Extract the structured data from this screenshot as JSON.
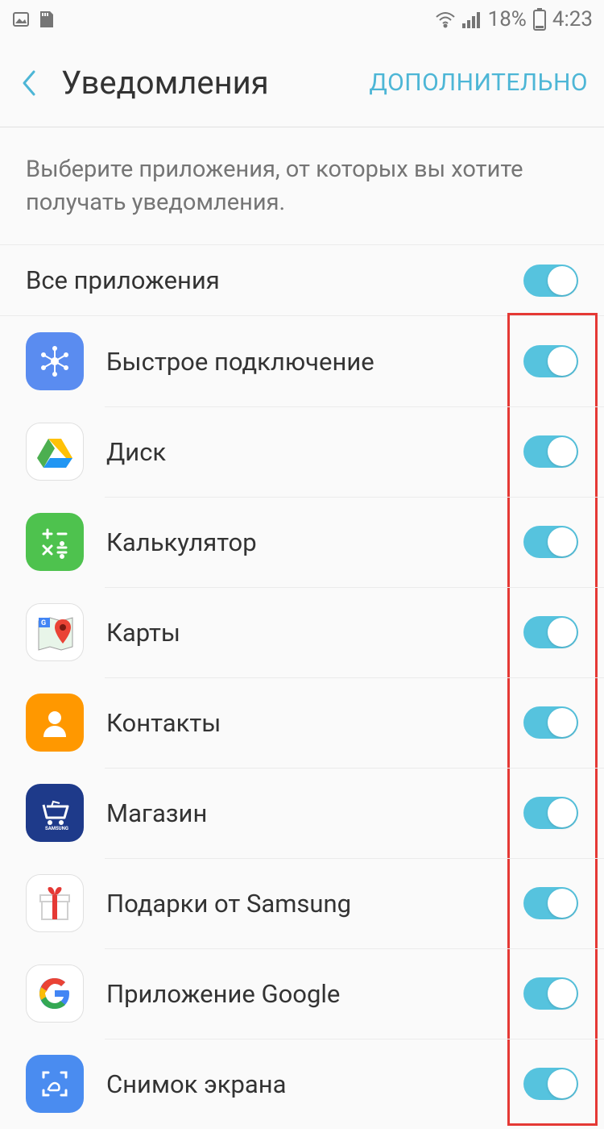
{
  "statusbar": {
    "battery_percent": "18%",
    "time": "4:23"
  },
  "header": {
    "title": "Уведомления",
    "action": "ДОПОЛНИТЕЛЬНО"
  },
  "description": "Выберите приложения, от которых вы хотите получать уведомления.",
  "all_apps": {
    "label": "Все приложения",
    "enabled": true
  },
  "apps": [
    {
      "name": "Быстрое подключение",
      "icon": "quick-connect",
      "enabled": true
    },
    {
      "name": "Диск",
      "icon": "drive",
      "enabled": true
    },
    {
      "name": "Калькулятор",
      "icon": "calculator",
      "enabled": true
    },
    {
      "name": "Карты",
      "icon": "maps",
      "enabled": true
    },
    {
      "name": "Контакты",
      "icon": "contacts",
      "enabled": true
    },
    {
      "name": "Магазин",
      "icon": "store",
      "enabled": true
    },
    {
      "name": "Подарки от Samsung",
      "icon": "gifts",
      "enabled": true
    },
    {
      "name": "Приложение Google",
      "icon": "google",
      "enabled": true
    },
    {
      "name": "Снимок экрана",
      "icon": "screenshot",
      "enabled": true
    }
  ]
}
